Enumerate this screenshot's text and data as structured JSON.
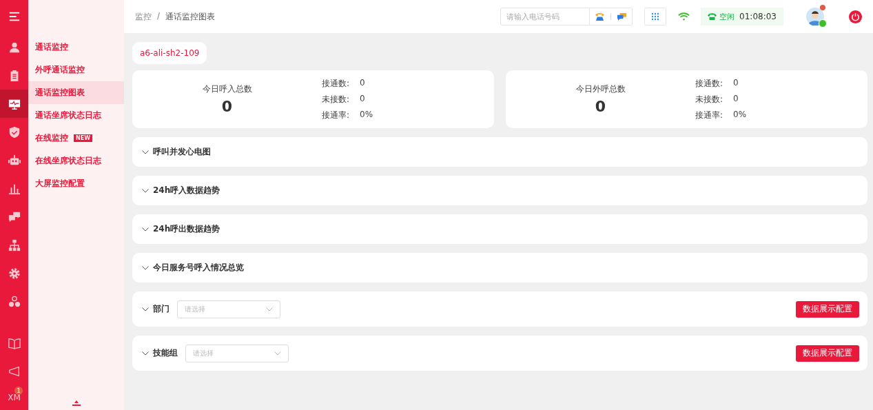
{
  "rail": {
    "items": [
      {
        "kind": "person",
        "selected": false
      },
      {
        "kind": "clipboard",
        "selected": false
      },
      {
        "kind": "monitor",
        "selected": true
      },
      {
        "kind": "shield",
        "selected": false
      },
      {
        "kind": "robot",
        "selected": false
      },
      {
        "kind": "chart",
        "selected": false
      },
      {
        "kind": "chat",
        "selected": false
      },
      {
        "kind": "org",
        "selected": false
      },
      {
        "kind": "gear",
        "selected": false
      },
      {
        "kind": "hex",
        "selected": false
      }
    ],
    "bottom": [
      {
        "kind": "book"
      },
      {
        "kind": "megaphone"
      }
    ],
    "user_text": "XM",
    "user_badge": "1"
  },
  "submenu": {
    "items": [
      {
        "label": "通话监控",
        "selected": false
      },
      {
        "label": "外呼通话监控",
        "selected": false
      },
      {
        "label": "通话监控图表",
        "selected": true
      },
      {
        "label": "通话坐席状态日志",
        "selected": false
      },
      {
        "label": "在线监控",
        "selected": false,
        "tag": "NEW"
      },
      {
        "label": "在线坐席状态日志",
        "selected": false
      },
      {
        "label": "大屏监控配置",
        "selected": false
      }
    ]
  },
  "header": {
    "breadcrumb": [
      "监控",
      "通话监控图表"
    ],
    "separator": "/",
    "phone_search": {
      "placeholder": "请输入电话号码"
    },
    "status": "空闲",
    "timer": "01:08:03"
  },
  "server_tag": "a6-ali-sh2-109",
  "stat_cards": [
    {
      "title": "今日呼入总数",
      "total": "0",
      "rows": [
        {
          "label": "接通数:",
          "value": "0"
        },
        {
          "label": "未接数:",
          "value": "0"
        },
        {
          "label": "接通率:",
          "value": "0%"
        }
      ]
    },
    {
      "title": "今日外呼总数",
      "total": "0",
      "rows": [
        {
          "label": "接通数:",
          "value": "0"
        },
        {
          "label": "未接数:",
          "value": "0"
        },
        {
          "label": "接通率:",
          "value": "0%"
        }
      ]
    }
  ],
  "sections": [
    {
      "title": "呼叫并发心电图",
      "expanded": false
    },
    {
      "title": "24h呼入数据趋势",
      "expanded": false
    },
    {
      "title": "24h呼出数据趋势",
      "expanded": false
    },
    {
      "title": "今日服务号呼入情况总览",
      "expanded": false
    },
    {
      "title": "部门",
      "expanded": false,
      "select": {
        "placeholder": "请选择"
      },
      "button": "数据展示配置"
    },
    {
      "title": "技能组",
      "expanded": false,
      "select": {
        "placeholder": "请选择"
      },
      "button": "数据展示配置"
    }
  ]
}
